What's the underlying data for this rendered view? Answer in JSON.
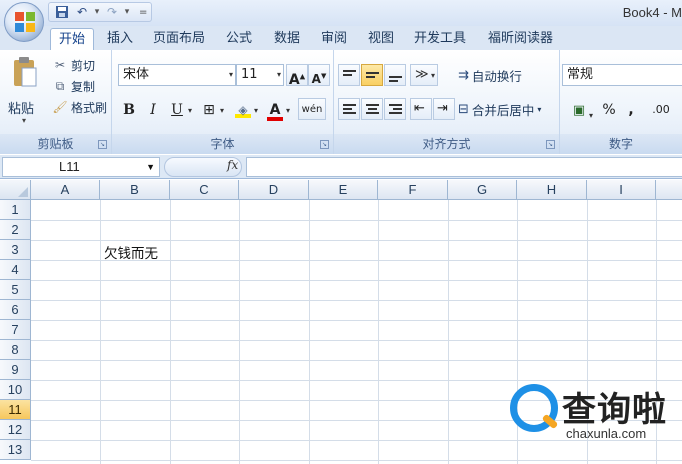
{
  "window": {
    "title": "Book4 - M"
  },
  "qat": {
    "save": "save-icon",
    "undo": "undo-icon",
    "redo": "redo-icon",
    "customize": "="
  },
  "tabs": [
    {
      "label": "开始",
      "active": true
    },
    {
      "label": "插入"
    },
    {
      "label": "页面布局"
    },
    {
      "label": "公式"
    },
    {
      "label": "数据"
    },
    {
      "label": "审阅"
    },
    {
      "label": "视图"
    },
    {
      "label": "开发工具"
    },
    {
      "label": "福昕阅读器"
    }
  ],
  "ribbon": {
    "clipboard": {
      "paste": "粘贴",
      "cut": "剪切",
      "copy": "复制",
      "format_painter": "格式刷",
      "group": "剪贴板"
    },
    "font": {
      "name": "宋体",
      "size": "11",
      "bold": "B",
      "italic": "I",
      "underline": "U",
      "font_color_glyph": "A",
      "phonetic": "wén",
      "group": "字体"
    },
    "alignment": {
      "wrap_text": "自动换行",
      "merge_center": "合并后居中",
      "group": "对齐方式"
    },
    "number": {
      "format": "常规",
      "percent": "%",
      "comma": ",",
      "decimal_inc": ".00",
      "group": "数字"
    }
  },
  "formula_bar": {
    "name_box": "L11",
    "fx": "fx",
    "value": ""
  },
  "columns": [
    "A",
    "B",
    "C",
    "D",
    "E",
    "F",
    "G",
    "H",
    "I"
  ],
  "rows": [
    "1",
    "2",
    "3",
    "4",
    "5",
    "6",
    "7",
    "8",
    "9",
    "10",
    "11",
    "12",
    "13"
  ],
  "active_row": "11",
  "cells": {
    "B3": "欠钱而无"
  },
  "watermark": {
    "title": "查询啦",
    "url": "chaxunla.com"
  },
  "colors": {
    "accent": "#1e90e6",
    "active_row": "#f6c75d"
  }
}
